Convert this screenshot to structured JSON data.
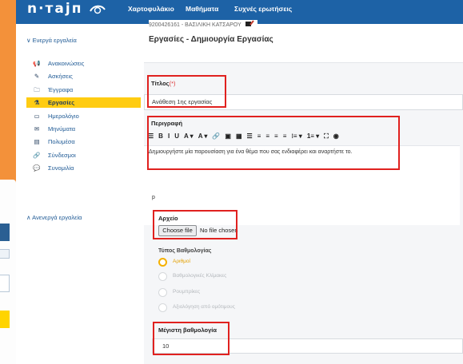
{
  "app": {
    "logo_text": "n·тајп",
    "nav": [
      "Χαρτοφυλάκιο",
      "Μαθήματα",
      "Συχνές ερωτήσεις"
    ],
    "user_line": "9200426161 - ΒΑΣΙΛΙΚΗ ΚΑΤΣΑΡΟΥ"
  },
  "sidebar": {
    "active_tools_label": "∨ Ενεργά εργαλεία",
    "items": [
      {
        "label": "Ανακοινώσεις",
        "icon": "megaphone-icon",
        "glyph": "📢"
      },
      {
        "label": "Ασκήσεις",
        "icon": "pencil-icon",
        "glyph": "✎"
      },
      {
        "label": "Έγγραφα",
        "icon": "folder-icon",
        "glyph": "🗀"
      },
      {
        "label": "Εργασίες",
        "icon": "flask-icon",
        "glyph": "⚗"
      },
      {
        "label": "Ημερολόγιο",
        "icon": "calendar-icon",
        "glyph": "▭"
      },
      {
        "label": "Μηνύματα",
        "icon": "envelope-icon",
        "glyph": "✉"
      },
      {
        "label": "Πολυμέσα",
        "icon": "film-icon",
        "glyph": "▤"
      },
      {
        "label": "Σύνδεσμοι",
        "icon": "link-icon",
        "glyph": "🔗"
      },
      {
        "label": "Συνομιλία",
        "icon": "chat-icon",
        "glyph": "💬"
      }
    ],
    "active_item_index": 3,
    "inactive_tools_label": "∧ Ανενεργά εργαλεία",
    "colors": {
      "active_bg": "#ffcc12",
      "link": "#1f5a95"
    }
  },
  "page": {
    "title": "Εργασίες - Δημιουργία Εργασίας"
  },
  "form": {
    "title_label": "Τίτλος",
    "title_required": "(*)",
    "title_value": "Ανάθεση 1ης εργασίας",
    "description_label": "Περιγραφή",
    "toolbar": [
      {
        "glyph": "☰",
        "icon": "paragraph-icon"
      },
      {
        "glyph": "B",
        "icon": "bold-icon"
      },
      {
        "glyph": "I",
        "icon": "italic-icon"
      },
      {
        "glyph": "U",
        "icon": "underline-icon"
      },
      {
        "glyph": "A ▾",
        "icon": "font-color-icon"
      },
      {
        "glyph": "A ▾",
        "icon": "highlight-icon"
      },
      {
        "glyph": "🔗",
        "icon": "link-icon"
      },
      {
        "glyph": "▣",
        "icon": "image-icon"
      },
      {
        "glyph": "▦",
        "icon": "media-icon"
      },
      {
        "glyph": "☰",
        "icon": "hr-icon"
      },
      {
        "glyph": "≡",
        "icon": "align-left-icon"
      },
      {
        "glyph": "≡",
        "icon": "align-center-icon"
      },
      {
        "glyph": "≡",
        "icon": "align-right-icon"
      },
      {
        "glyph": "≡",
        "icon": "align-justify-icon"
      },
      {
        "glyph": "⁝≡ ▾",
        "icon": "bullet-list-icon"
      },
      {
        "glyph": "1≡ ▾",
        "icon": "numbered-list-icon"
      },
      {
        "glyph": "⛶",
        "icon": "fullscreen-icon"
      },
      {
        "glyph": "◉",
        "icon": "preview-icon"
      }
    ],
    "description_text": "Δημιουργήστε μία παρουσίαση για ένα θέμα που σας ενδιαφέρει και αναρτήστε το.",
    "editor_status": "p",
    "file_label": "Αρχείο",
    "file_button": "Choose file",
    "file_status": "No file chosen",
    "grading_label": "Τύπος Βαθμολογίας",
    "grading_options": [
      {
        "label": "Αριθμοί",
        "selected": true
      },
      {
        "label": "Βαθμολογικές Κλίμακες",
        "selected": false
      },
      {
        "label": "Ρουμπρίκες",
        "selected": false
      },
      {
        "label": "Αξιολόγηση από ομότιμους",
        "selected": false
      }
    ],
    "max_grade_label": "Μέγιστη βαθμολογία",
    "max_grade_value": "10"
  },
  "colors": {
    "topbar": "#1d62a6",
    "frame": "#f3913a",
    "highlight_box": "#e0211f",
    "radio_selected": "#f5b000"
  }
}
